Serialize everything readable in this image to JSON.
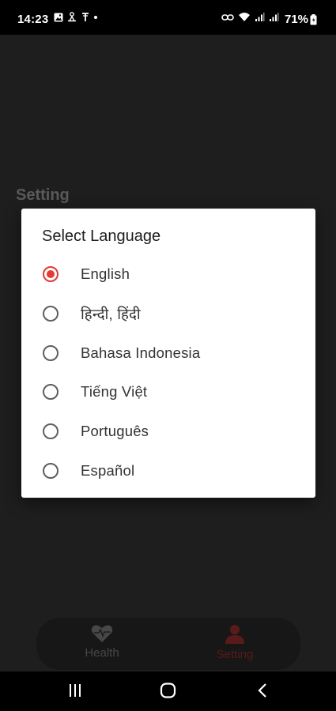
{
  "status_bar": {
    "time": "14:23",
    "battery": "71%",
    "left_icons": [
      "image-icon",
      "accessibility-icon",
      "signal-antenna-icon"
    ],
    "right_icons": [
      "link-icon",
      "wifi-icon",
      "cell-signal-icon",
      "cell-signal-icon",
      "battery-icon"
    ]
  },
  "page": {
    "title": "Setting"
  },
  "dialog": {
    "title": "Select Language",
    "options": [
      {
        "label": "English",
        "selected": true
      },
      {
        "label": "हिन्दी, हिंदी",
        "selected": false
      },
      {
        "label": "Bahasa Indonesia",
        "selected": false
      },
      {
        "label": "Tiếng Việt",
        "selected": false
      },
      {
        "label": "Português",
        "selected": false
      },
      {
        "label": "Español",
        "selected": false
      }
    ]
  },
  "bottom_nav": {
    "items": [
      {
        "label": "Health",
        "icon": "heart-icon",
        "active": false
      },
      {
        "label": "Setting",
        "icon": "person-icon",
        "active": true
      }
    ]
  },
  "system_nav": {
    "buttons": [
      "recents-icon",
      "home-icon",
      "back-icon"
    ]
  },
  "colors": {
    "accent": "#e53935",
    "background": "#1e1e1e",
    "dialog": "#ffffff"
  }
}
